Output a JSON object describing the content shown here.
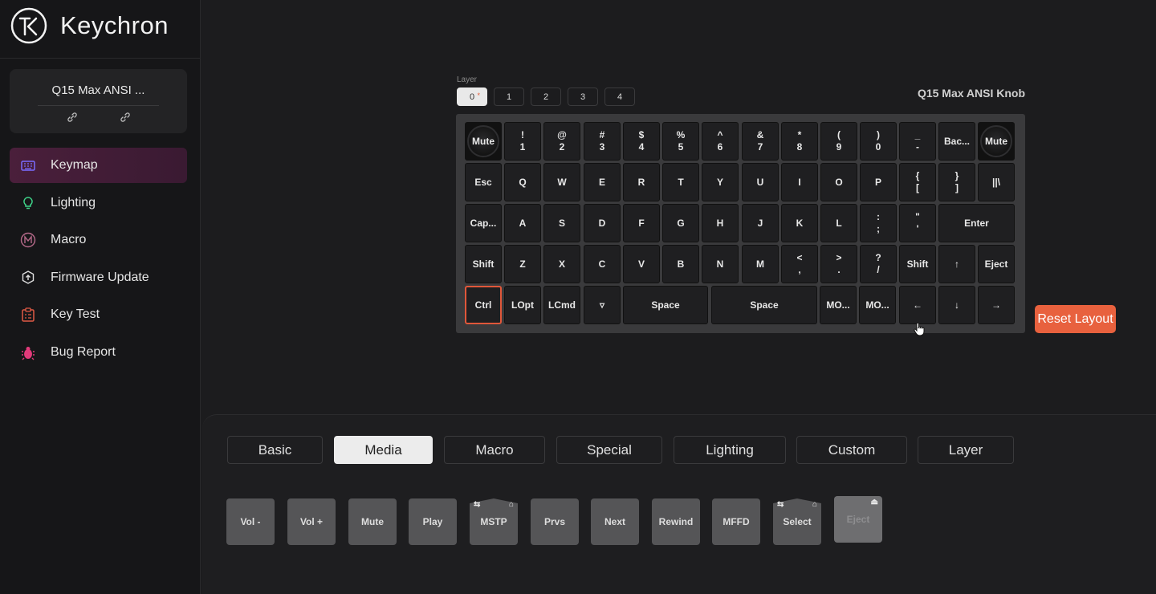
{
  "brand": {
    "name": "Keychron",
    "logo_letters": "K"
  },
  "device": {
    "name": "Q15 Max ANSI ...",
    "icons": [
      "link-icon",
      "unlink-icon"
    ]
  },
  "nav": {
    "items": [
      {
        "label": "Keymap",
        "icon": "keyboard-icon",
        "active": true
      },
      {
        "label": "Lighting",
        "icon": "lightbulb-icon",
        "active": false
      },
      {
        "label": "Macro",
        "icon": "macro-m-icon",
        "active": false
      },
      {
        "label": "Firmware Update",
        "icon": "firmware-update-icon",
        "active": false
      },
      {
        "label": "Key Test",
        "icon": "key-test-icon",
        "active": false
      },
      {
        "label": "Bug Report",
        "icon": "bug-icon",
        "active": false
      }
    ]
  },
  "layer": {
    "caption": "Layer",
    "tabs": [
      "0",
      "1",
      "2",
      "3",
      "4"
    ],
    "active": "0",
    "modified_marker": "*"
  },
  "keyboard": {
    "title": "Q15 Max ANSI Knob",
    "rows": [
      [
        "Mute",
        "!|1",
        "@|2",
        "#|3",
        "$|4",
        "%|5",
        "^|6",
        "&|7",
        "*|8",
        "(|9",
        ")|0",
        "_|-",
        "Bac...",
        "Mute"
      ],
      [
        "Esc",
        "Q",
        "W",
        "E",
        "R",
        "T",
        "Y",
        "U",
        "I",
        "O",
        "P",
        "{|[",
        "}|]",
        "||\\"
      ],
      [
        "Cap...",
        "A",
        "S",
        "D",
        "F",
        "G",
        "H",
        "J",
        "K",
        "L",
        ":|;",
        "\"|'",
        "Enter"
      ],
      [
        "Shift",
        "Z",
        "X",
        "C",
        "V",
        "B",
        "N",
        "M",
        "<|,",
        ">|.",
        "?|/",
        "Shift",
        "↑",
        "Eject"
      ],
      [
        "Ctrl",
        "LOpt",
        "LCmd",
        "▿",
        "Space",
        "Space",
        "MO...",
        "MO...",
        "←",
        "↓",
        "→"
      ]
    ],
    "selected_key": "Ctrl"
  },
  "reset_button": {
    "label": "Reset Layout"
  },
  "categories": {
    "tabs": [
      "Basic",
      "Media",
      "Macro",
      "Special",
      "Lighting",
      "Custom",
      "Layer"
    ],
    "active": "Media"
  },
  "media_keys": [
    {
      "label": "Vol -"
    },
    {
      "label": "Vol +"
    },
    {
      "label": "Mute"
    },
    {
      "label": "Play"
    },
    {
      "label": "MSTP",
      "corner_left": "⇆",
      "corner_right": "⌂"
    },
    {
      "label": "Prvs"
    },
    {
      "label": "Next"
    },
    {
      "label": "Rewind"
    },
    {
      "label": "MFFD"
    },
    {
      "label": "Select",
      "corner_left": "⇆",
      "corner_right": "⌂"
    },
    {
      "label": "Eject",
      "corner_right": "⏏",
      "disabled": true
    }
  ],
  "colors": {
    "accent": "#e8613e",
    "nav_active": "#4a1f3b",
    "selected_key_border": "#e0573a"
  }
}
